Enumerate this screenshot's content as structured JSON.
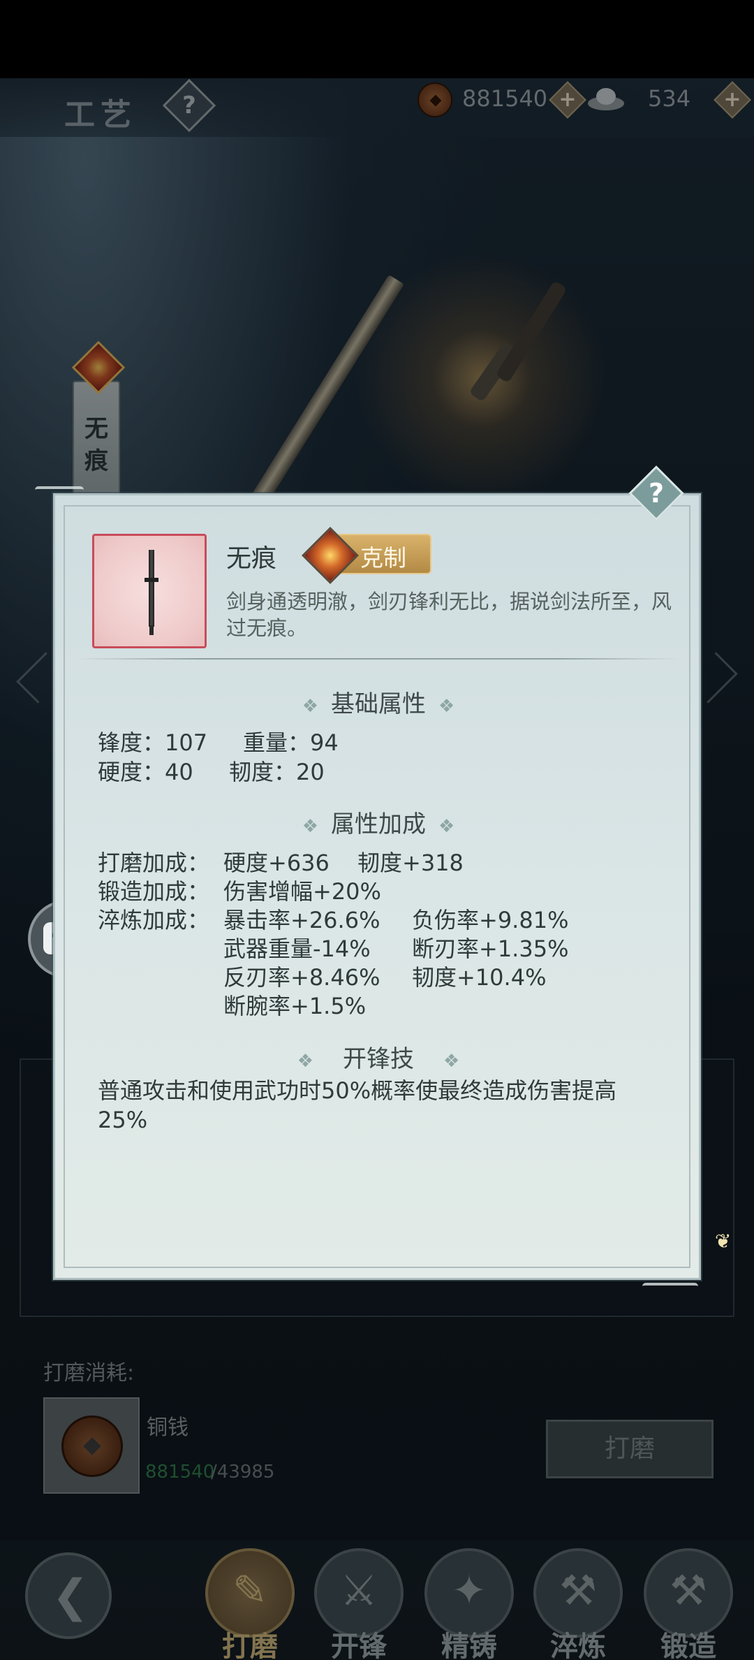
{
  "header": {
    "title": "工艺",
    "help_icon": "question-icon",
    "currencies": [
      {
        "name": "copper-coin",
        "value": "881540",
        "add_icon": "plus-icon"
      },
      {
        "name": "silver-ingot",
        "value": "534",
        "add_icon": "plus-icon"
      }
    ]
  },
  "side_tab": {
    "label_line1": "无",
    "label_line2": "痕"
  },
  "modal": {
    "item": {
      "name": "无痕",
      "badge": "克制",
      "description": "剑身通透明澈，剑刃锋利无比，据说剑法所至，风过无痕。"
    },
    "base_section": {
      "title": "基础属性",
      "rows": [
        [
          "锋度：107",
          "重量：94"
        ],
        [
          "硬度：40",
          "韧度：20"
        ]
      ]
    },
    "bonus_section": {
      "title": "属性加成",
      "grind_label": "打磨加成：",
      "grind_values": [
        "硬度+636",
        "韧度+318"
      ],
      "forge_label": "锻造加成：",
      "forge_values": [
        "伤害增幅+20%"
      ],
      "temper_label": "淬炼加成：",
      "temper_values": [
        [
          "暴击率+26.6%",
          "负伤率+9.81%"
        ],
        [
          "武器重量-14%",
          "断刃率+1.35%"
        ],
        [
          "反刃率+8.46%",
          "韧度+10.4%"
        ],
        [
          "断腕率+1.5%"
        ]
      ]
    },
    "skill_section": {
      "title": "开锋技",
      "text": "普通攻击和使用武功时50%概率使最终造成伤害提高25%"
    },
    "deco_symbol": "❖"
  },
  "cost": {
    "label": "打磨消耗:",
    "item_name": "铜钱",
    "have": "881540",
    "need": "/43985",
    "action_button": "打磨"
  },
  "bottom_nav": {
    "back_icon": "back-arrow-icon",
    "items": [
      {
        "label": "打磨",
        "icon": "grind-icon",
        "glyph": "✎",
        "active": true
      },
      {
        "label": "开锋",
        "icon": "sword-sharpen-icon",
        "glyph": "⚔",
        "active": false
      },
      {
        "label": "精铸",
        "icon": "shuriken-icon",
        "glyph": "✦",
        "active": false
      },
      {
        "label": "淬炼",
        "icon": "temper-icon",
        "glyph": "⚒",
        "active": false
      },
      {
        "label": "锻造",
        "icon": "anvil-icon",
        "glyph": "⚒",
        "active": false
      }
    ]
  },
  "colors": {
    "accent_gold": "#c9b27a",
    "have_green": "#2f7a4a",
    "item_frame_red": "#c94c5a"
  }
}
